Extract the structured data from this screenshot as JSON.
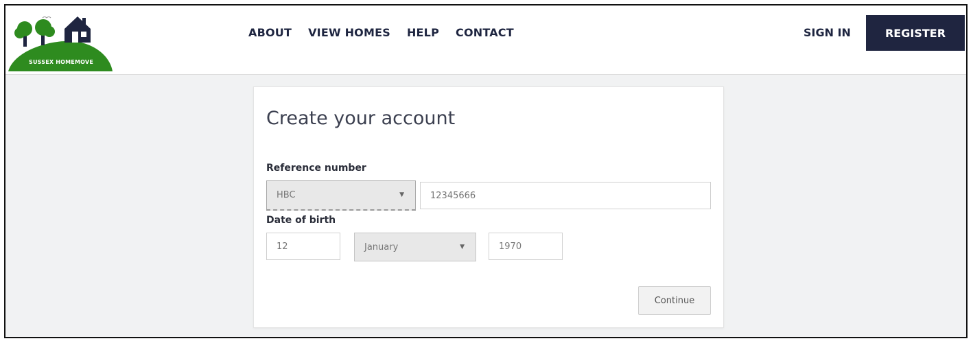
{
  "brand": {
    "logo_text": "SUSSEX HOMEMOVE"
  },
  "nav": {
    "items": [
      {
        "label": "ABOUT"
      },
      {
        "label": "VIEW HOMES"
      },
      {
        "label": "HELP"
      },
      {
        "label": "CONTACT"
      }
    ],
    "sign_in": "SIGN IN",
    "register": "REGISTER"
  },
  "colors": {
    "brand_navy": "#1f2540",
    "logo_green": "#2e8b1f",
    "page_bg": "#f1f2f3"
  },
  "form": {
    "title": "Create your account",
    "reference_label": "Reference number",
    "reference_prefix": "HBC",
    "reference_value": "12345666",
    "dob_label": "Date of birth",
    "dob_day": "12",
    "dob_month": "January",
    "dob_year": "1970",
    "continue_label": "Continue"
  }
}
